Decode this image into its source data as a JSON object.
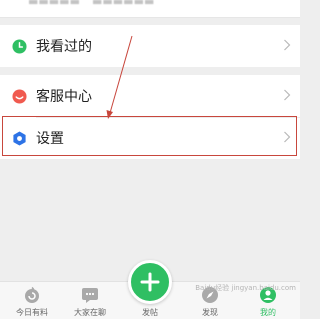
{
  "menu": {
    "history_label": "我看过的",
    "service_label": "客服中心",
    "settings_label": "设置"
  },
  "tabs": [
    {
      "label": "今日有料"
    },
    {
      "label": "大家在聊"
    },
    {
      "label": "发帖"
    },
    {
      "label": "发现"
    },
    {
      "label": "我的"
    }
  ],
  "colors": {
    "accent_green": "#2fbf63",
    "highlight_red": "#c8473d",
    "service_red": "#f05a4f",
    "settings_blue": "#2d73e6"
  },
  "watermark_text": "Baidu经验 jingyan.baidu.com"
}
